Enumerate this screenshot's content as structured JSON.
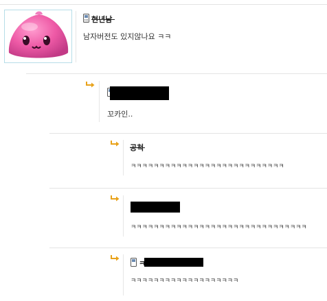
{
  "comments": [
    {
      "author": "현년남",
      "text": "남자버전도 있지않나요 ㅋㅋ"
    },
    {
      "author": "",
      "text": "꼬카인.."
    },
    {
      "author": "공척",
      "text": "ㅋㅋㅋㅋㅋㅋㅋㅋㅋㅋㅋㅋㅋㅋㅋㅋㅋㅋㅋㅋㅋㅋㅋㅋㅋㅋㅋ"
    },
    {
      "author": "",
      "text": "ㅋㅋㅋㅋㅋㅋㅋㅋㅋㅋㅋㅋㅋㅋㅋㅋㅋㅋㅋㅋㅋㅋㅋㅋㅋㅋㅋㅋㅋㅋㅋ"
    },
    {
      "author": "ㅋ",
      "text": "ㅋㅋㅋㅋㅋㅋㅋㅋㅋㅋㅋㅋㅋㅋㅋㅋㅋㅋㅋ"
    }
  ],
  "icons": {
    "reply": "reply-arrow-icon",
    "mobile": "mobile-phone-icon",
    "avatar": "pink-blob-avatar"
  },
  "colors": {
    "reply_arrow": "#e8a21a",
    "avatar_border": "#b6dde8",
    "separator": "#e3e3e3"
  }
}
